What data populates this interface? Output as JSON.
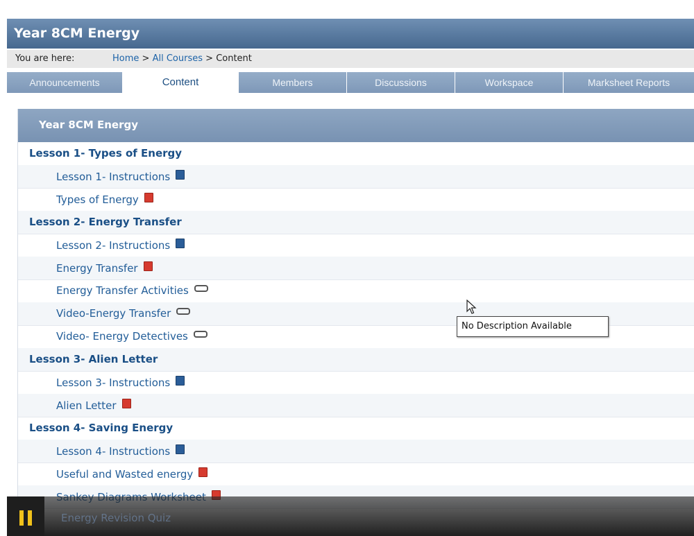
{
  "header": {
    "title": "Year 8CM Energy"
  },
  "breadcrumb": {
    "label": "You are here:",
    "home": "Home",
    "sep1": ">",
    "courses": "All Courses",
    "sep2": ">",
    "current": "Content"
  },
  "tabs": [
    {
      "label": "Announcements"
    },
    {
      "label": "Content"
    },
    {
      "label": "Members"
    },
    {
      "label": "Discussions"
    },
    {
      "label": "Workspace"
    },
    {
      "label": "Marksheet Reports"
    }
  ],
  "section": {
    "title": "Year 8CM Energy"
  },
  "rows": [
    {
      "label": "Lesson 1- Types of Energy",
      "type": "lesson"
    },
    {
      "label": "Lesson 1- Instructions",
      "type": "item",
      "icon": "doc-icon"
    },
    {
      "label": "Types of Energy",
      "type": "item",
      "icon": "pdf-icon"
    },
    {
      "label": "Lesson 2- Energy Transfer",
      "type": "lesson"
    },
    {
      "label": "Lesson 2- Instructions",
      "type": "item",
      "icon": "doc-icon"
    },
    {
      "label": "Energy Transfer",
      "type": "item",
      "icon": "pdf-icon"
    },
    {
      "label": "Energy Transfer Activities",
      "type": "item",
      "icon": "link-icon"
    },
    {
      "label": "Video-Energy Transfer",
      "type": "item",
      "icon": "link-icon"
    },
    {
      "label": "Video- Energy Detectives",
      "type": "item",
      "icon": "link-icon"
    },
    {
      "label": "Lesson 3- Alien Letter",
      "type": "lesson"
    },
    {
      "label": "Lesson 3- Instructions",
      "type": "item",
      "icon": "doc-icon"
    },
    {
      "label": "Alien Letter",
      "type": "item",
      "icon": "pdf-icon"
    },
    {
      "label": "Lesson 4- Saving Energy",
      "type": "lesson"
    },
    {
      "label": "Lesson 4- Instructions",
      "type": "item",
      "icon": "doc-icon"
    },
    {
      "label": "Useful and Wasted energy",
      "type": "item",
      "icon": "pdf-icon"
    },
    {
      "label": "Sankey Diagrams Worksheet",
      "type": "item",
      "icon": "pdf-icon"
    }
  ],
  "tooltip": {
    "text": "No Description Available"
  },
  "player": {
    "state_icon": "pause-icon",
    "obscured_text": "Energy Revision Quiz"
  },
  "colors": {
    "header": "#46688f",
    "link": "#225d98",
    "pause": "#f1c21b"
  }
}
